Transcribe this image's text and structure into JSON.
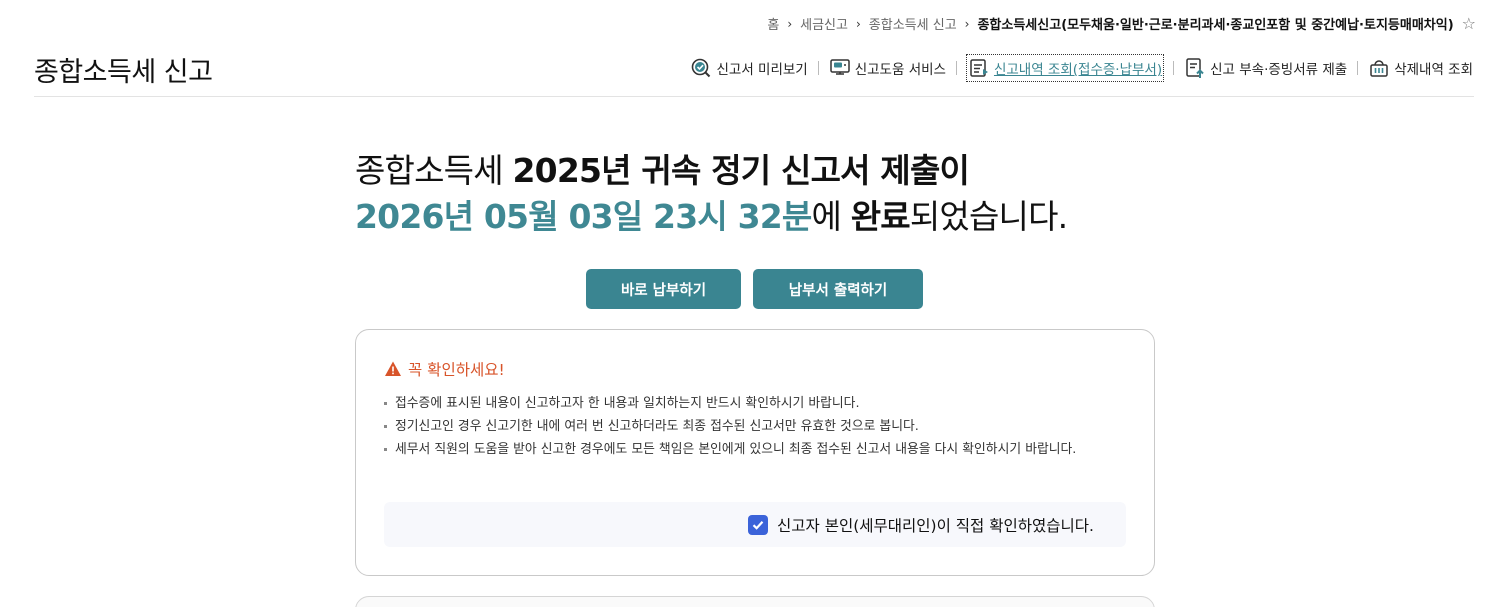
{
  "breadcrumb": {
    "items": [
      "홈",
      "세금신고",
      "종합소득세 신고",
      "종합소득세신고(모두채움·일반·근로·분리과세·종교인포함 및 중간예납·토지등매매차익)"
    ],
    "favorite_icon": "star-icon"
  },
  "header": {
    "title": "종합소득세 신고",
    "nav": [
      {
        "label": "신고서 미리보기",
        "icon": "magnifier-check-icon"
      },
      {
        "label": "신고도움 서비스",
        "icon": "monitor-chat-icon"
      },
      {
        "label": "신고내역 조회(접수증·납부서)",
        "icon": "document-list-icon"
      },
      {
        "label": "신고 부속·증빙서류 제출",
        "icon": "document-upload-icon"
      },
      {
        "label": "삭제내역 조회",
        "icon": "trash-basket-icon"
      }
    ]
  },
  "hero": {
    "line1_prefix": "종합소득세 ",
    "line1_bold": "2025년 귀속 정기 신고서 제출이",
    "datetime": "2026년 05월 03일 23시 32분",
    "line2_mid": "에 ",
    "line2_bold": "완료",
    "line2_suffix": "되었습니다."
  },
  "buttons": {
    "pay_now": "바로 납부하기",
    "print_bill": "납부서 출력하기"
  },
  "notice": {
    "title": "꼭 확인하세요!",
    "items": [
      "접수증에 표시된 내용이 신고하고자 한 내용과 일치하는지 반드시 확인하시기 바랍니다.",
      "정기신고인 경우 신고기한 내에 여러 번 신고하더라도 최종 접수된 신고서만 유효한 것으로 봅니다.",
      "세무서 직원의 도움을 받아 신고한 경우에도 모든 책임은 본인에게 있으니 최종 접수된 신고서 내용을 다시 확인하시기 바랍니다."
    ],
    "confirm_label": "신고자 본인(세무대리인)이 직접 확인하였습니다.",
    "confirm_checked": true
  },
  "colors": {
    "accent": "#3a8591",
    "warning": "#d8542a",
    "checkbox": "#3b63d9"
  }
}
